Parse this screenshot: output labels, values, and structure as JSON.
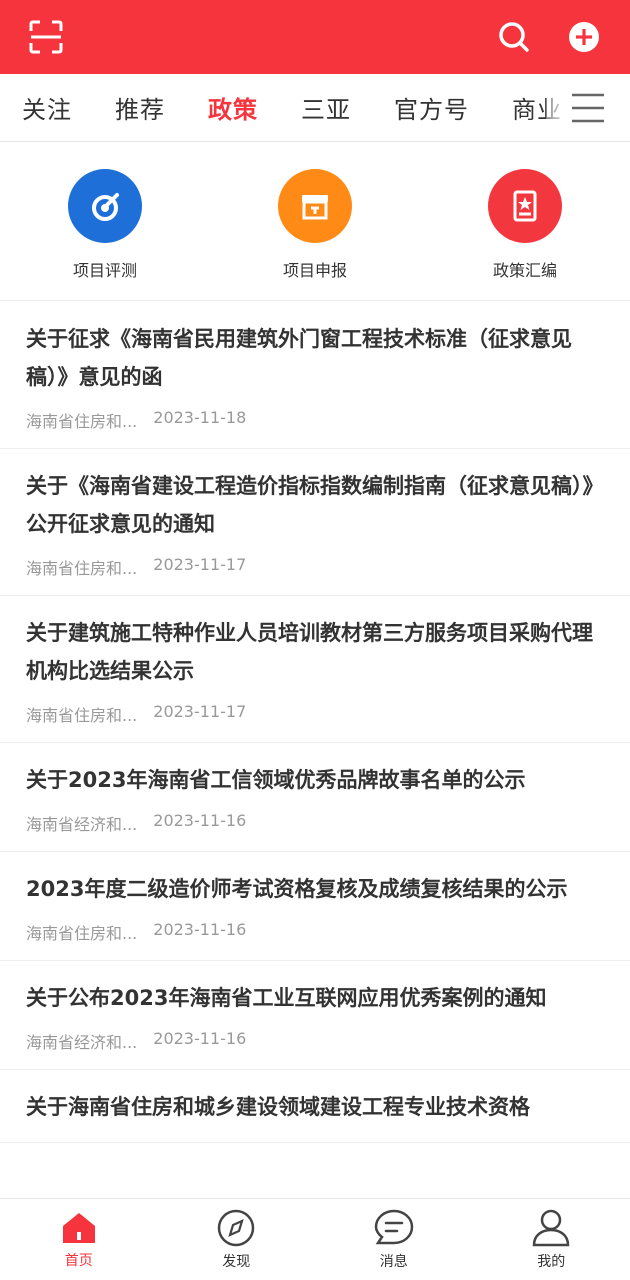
{
  "header": {
    "scan_icon": "scan-icon",
    "search_icon": "search-icon",
    "add_icon": "plus-circle-icon",
    "brand_color": "#f5343d"
  },
  "tabs": [
    {
      "label": "关注"
    },
    {
      "label": "推荐"
    },
    {
      "label": "政策",
      "active": true
    },
    {
      "label": "三亚"
    },
    {
      "label": "官方号"
    },
    {
      "label": "商业"
    }
  ],
  "quick_actions": [
    {
      "label": "项目评测",
      "color": "#1f6fd9",
      "icon": "gauge-icon"
    },
    {
      "label": "项目申报",
      "color": "#ff8a16",
      "icon": "box-icon"
    },
    {
      "label": "政策汇编",
      "color": "#f2373f",
      "icon": "document-star-icon"
    }
  ],
  "news": [
    {
      "title": "关于征求《海南省民用建筑外门窗工程技术标准（征求意见稿）》意见的函",
      "source": "海南省住房和...",
      "date": "2023-11-18"
    },
    {
      "title": "关于《海南省建设工程造价指标指数编制指南（征求意见稿）》公开征求意见的通知",
      "source": "海南省住房和...",
      "date": "2023-11-17"
    },
    {
      "title": "关于建筑施工特种作业人员培训教材第三方服务项目采购代理机构比选结果公示",
      "source": "海南省住房和...",
      "date": "2023-11-17"
    },
    {
      "title": "关于2023年海南省工信领域优秀品牌故事名单的公示",
      "source": "海南省经济和...",
      "date": "2023-11-16"
    },
    {
      "title": "2023年度二级造价师考试资格复核及成绩复核结果的公示",
      "source": "海南省住房和...",
      "date": "2023-11-16"
    },
    {
      "title": "关于公布2023年海南省工业互联网应用优秀案例的通知",
      "source": "海南省经济和...",
      "date": "2023-11-16"
    },
    {
      "title": "关于海南省住房和城乡建设领域建设工程专业技术资格",
      "source": "",
      "date": ""
    }
  ],
  "bottom_nav": [
    {
      "label": "首页",
      "icon": "home-icon",
      "active": true
    },
    {
      "label": "发现",
      "icon": "compass-icon"
    },
    {
      "label": "消息",
      "icon": "message-icon"
    },
    {
      "label": "我的",
      "icon": "user-icon"
    }
  ]
}
